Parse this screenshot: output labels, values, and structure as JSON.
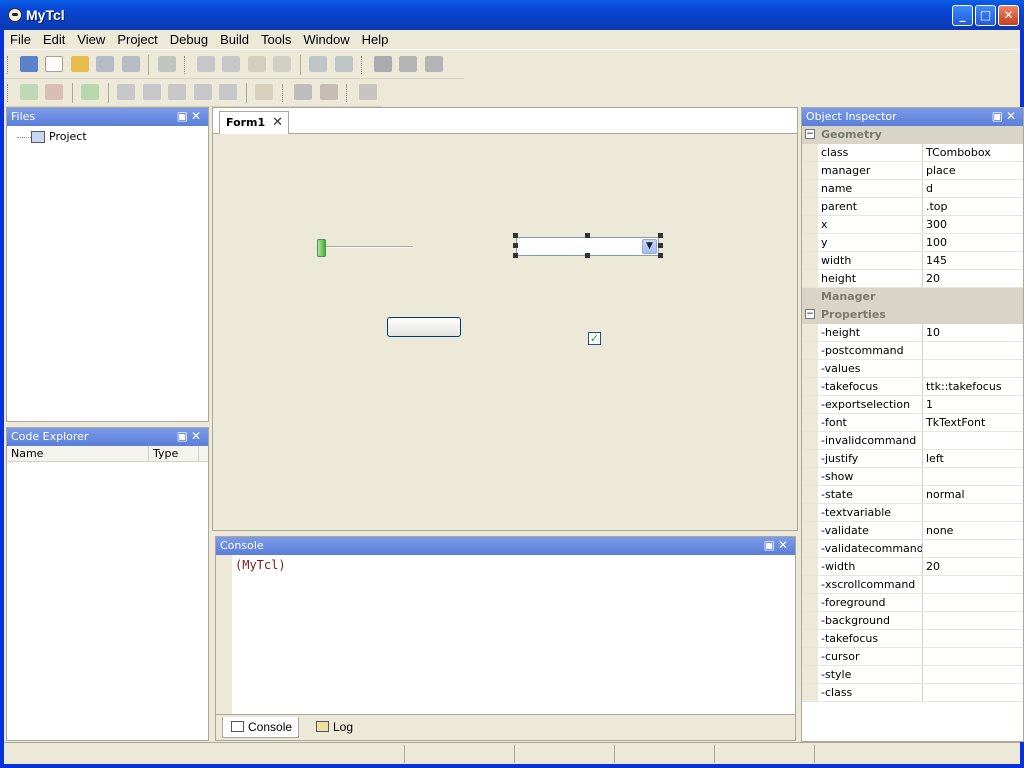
{
  "window": {
    "title": "MyTcl"
  },
  "menu": [
    "File",
    "Edit",
    "View",
    "Project",
    "Debug",
    "Build",
    "Tools",
    "Window",
    "Help"
  ],
  "files_panel": {
    "title": "Files",
    "tree_item": "Project"
  },
  "code_explorer": {
    "title": "Code Explorer",
    "col_name": "Name",
    "col_type": "Type"
  },
  "document": {
    "tab_label": "Form1"
  },
  "console": {
    "title": "Console",
    "prompt": "(MyTcl)",
    "tab_console": "Console",
    "tab_log": "Log"
  },
  "inspector": {
    "title": "Object Inspector",
    "cat_geometry": "Geometry",
    "geometry": [
      {
        "k": "class",
        "v": "TCombobox"
      },
      {
        "k": "manager",
        "v": "place"
      },
      {
        "k": "name",
        "v": "d"
      },
      {
        "k": "parent",
        "v": ".top"
      },
      {
        "k": "x",
        "v": "300"
      },
      {
        "k": "y",
        "v": "100"
      },
      {
        "k": "width",
        "v": "145"
      },
      {
        "k": "height",
        "v": "20"
      }
    ],
    "cat_manager": "Manager",
    "cat_properties": "Properties",
    "properties": [
      {
        "k": "-height",
        "v": "10"
      },
      {
        "k": "-postcommand",
        "v": ""
      },
      {
        "k": "-values",
        "v": ""
      },
      {
        "k": "-takefocus",
        "v": "ttk::takefocus"
      },
      {
        "k": "-exportselection",
        "v": "1"
      },
      {
        "k": "-font",
        "v": "TkTextFont"
      },
      {
        "k": "-invalidcommand",
        "v": ""
      },
      {
        "k": "-justify",
        "v": "left"
      },
      {
        "k": "-show",
        "v": ""
      },
      {
        "k": "-state",
        "v": "normal"
      },
      {
        "k": "-textvariable",
        "v": ""
      },
      {
        "k": "-validate",
        "v": "none"
      },
      {
        "k": "-validatecommand",
        "v": ""
      },
      {
        "k": "-width",
        "v": "20"
      },
      {
        "k": "-xscrollcommand",
        "v": ""
      },
      {
        "k": "-foreground",
        "v": ""
      },
      {
        "k": "-background",
        "v": ""
      },
      {
        "k": "-takefocus",
        "v": ""
      },
      {
        "k": "-cursor",
        "v": ""
      },
      {
        "k": "-style",
        "v": ""
      },
      {
        "k": "-class",
        "v": ""
      }
    ]
  },
  "colors": {
    "title_bar": "#0a4fd8",
    "panel_header": "#6a8ae0",
    "prompt": "#7b1a1a"
  },
  "icons": {
    "toolbar1": [
      "new-project-icon",
      "new-file-icon",
      "open-icon",
      "save-icon",
      "save-all-icon",
      "print-icon",
      "cut-icon",
      "copy-icon",
      "paste-icon",
      "erase-icon",
      "undo-icon",
      "redo-icon",
      "find-icon",
      "find-next-icon",
      "replace-icon",
      "find-in-files-icon"
    ],
    "toolbar2": [
      "step-icon",
      "stop-icon",
      "run-icon",
      "indent-icon",
      "unindent-icon",
      "comment-icon",
      "uncomment-icon",
      "tab-icon",
      "hand-icon",
      "build-icon",
      "clean-icon",
      "settings-icon"
    ]
  }
}
